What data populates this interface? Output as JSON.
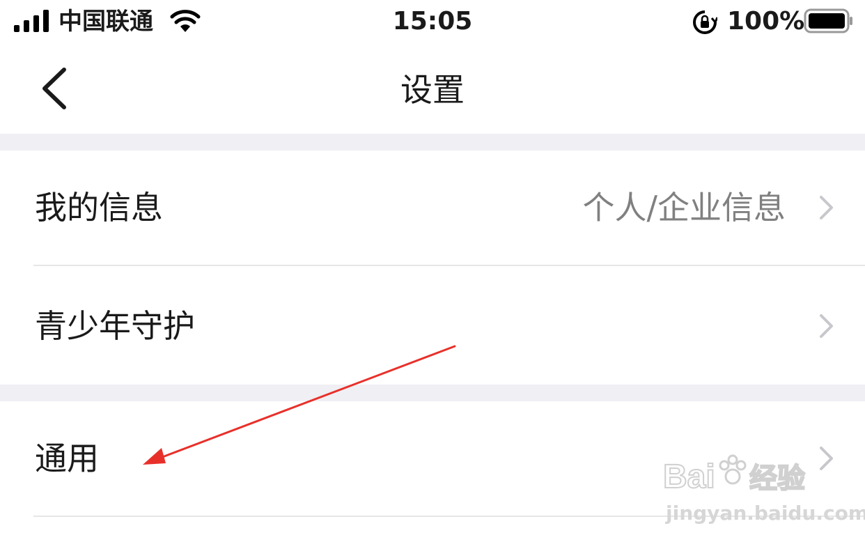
{
  "status_bar": {
    "carrier": "中国联通",
    "time": "15:05",
    "battery_percent": "100%"
  },
  "nav": {
    "title": "设置",
    "back_icon": "chevron-left-icon"
  },
  "settings": {
    "groups": [
      {
        "items": [
          {
            "label": "我的信息",
            "value": "个人/企业信息"
          },
          {
            "label": "青少年守护",
            "value": ""
          }
        ]
      },
      {
        "items": [
          {
            "label": "通用",
            "value": ""
          }
        ]
      }
    ]
  },
  "colors": {
    "background": "#ffffff",
    "section_gap": "#efeff4",
    "text_primary": "#1a1a1a",
    "text_secondary": "#808080",
    "chevron": "#c7c7cc",
    "annotation_arrow": "#e8302a"
  },
  "watermark": {
    "logo": "Bai 经验",
    "url": "jingyan.baidu.com"
  }
}
